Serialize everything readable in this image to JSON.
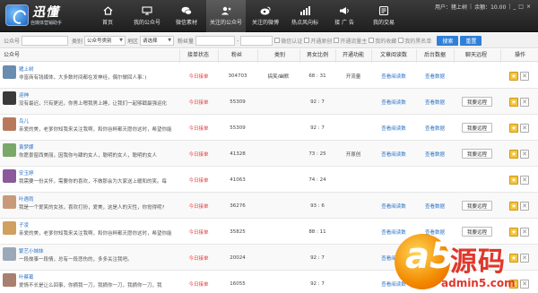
{
  "header": {
    "logo_main": "迅懂",
    "logo_sub": "自媒体营销助手",
    "nav": [
      {
        "label": "首页",
        "icon": "home-icon"
      },
      {
        "label": "我的公众号",
        "icon": "screen-icon"
      },
      {
        "label": "微信素材",
        "icon": "chat-icon"
      },
      {
        "label": "关注的公众号",
        "icon": "user-star-icon",
        "active": true
      },
      {
        "label": "关注的微博",
        "icon": "weibo-icon"
      },
      {
        "label": "热点风向标",
        "icon": "signal-icon"
      },
      {
        "label": "接 广 告",
        "icon": "ad-icon"
      },
      {
        "label": "我的交易",
        "icon": "trade-icon"
      }
    ],
    "user_label": "用户：猪上树",
    "balance_label": "余额：10.00",
    "window_buttons": [
      "_",
      "□",
      "×"
    ]
  },
  "filters": {
    "account_label": "公众号",
    "category_label": "类别",
    "category_value": "公众号类别",
    "region_label": "地区",
    "region_value": "请选择",
    "fans_label": "粉丝量",
    "fans_sep": "-",
    "checkboxes": [
      "微信认证",
      "开通原创",
      "开通流量主",
      "我的收藏",
      "我的黑名单"
    ],
    "search_button": "搜索",
    "reset_button": "重置"
  },
  "table": {
    "headers": [
      "公众号",
      "接单状态",
      "粉丝",
      "类别",
      "男女比例",
      "开通功能",
      "文章阅读数",
      "后台数据",
      "聊天远程",
      "操作"
    ],
    "rows": [
      {
        "name": "猪上树",
        "desc": "非富商有钱媒体，大多数时间都在发神经，偶尔做回人事：)",
        "status": "今日接单",
        "fans": "304703",
        "category": "搞笑/幽默",
        "ratio": "68 : 31",
        "features": "开流量",
        "read": "查看阅读数",
        "backend": "查看数据",
        "chat": "",
        "avatar": "#6a8caf"
      },
      {
        "name": "迎神",
        "desc": "没有最迟，只有更迟，你男上嗯我男上睡，让我们一起够戳最强运化",
        "status": "今日接单",
        "fans": "55309",
        "category": "",
        "ratio": "92 : 7",
        "features": "",
        "read": "查看阅读数",
        "backend": "查看数据",
        "chat": "我要远程",
        "avatar": "#3a3a3a"
      },
      {
        "name": "鸟儿",
        "desc": "亲爱的美，老爹你知我来关注我啊，和你谷畔都天愿你这时，希望你能",
        "status": "今日接单",
        "fans": "55309",
        "category": "",
        "ratio": "92 : 7",
        "features": "",
        "read": "查看阅读数",
        "backend": "查看数据",
        "chat": "我要远程",
        "avatar": "#b87a5a"
      },
      {
        "name": "袁梦娜",
        "desc": "你愿景窗西美丽，因我你与肆的女人，聪明的女人，聪明的女人",
        "status": "今日接单",
        "fans": "41328",
        "category": "",
        "ratio": "73 : 25",
        "features": "开原创",
        "read": "查看阅读数",
        "backend": "查看数据",
        "chat": "我要远程",
        "avatar": "#7aa86a"
      },
      {
        "name": "安玉婷",
        "desc": "我需要一份关怀，需要你的喜欢，不做那会为大家送上暖和的笑。每",
        "status": "今日接单",
        "fans": "41063",
        "category": "",
        "ratio": "74 : 24",
        "features": "",
        "read": "",
        "backend": "",
        "chat": "",
        "avatar": "#8a5a9a"
      },
      {
        "name": "叶遇雨",
        "desc": "我是一个爱笑的女孩，喜欢打扮，爱美，这是人的天性，你觉得呢?",
        "status": "今日接单",
        "fans": "36276",
        "category": "",
        "ratio": "93 : 6",
        "features": "",
        "read": "查看阅读数",
        "backend": "查看数据",
        "chat": "我要远程",
        "avatar": "#c89a7a"
      },
      {
        "name": "子凌",
        "desc": "亲爱的美，老爹你知我来关注我啊，和你谷畔都天愿你这时，希望你能",
        "status": "今日接单",
        "fans": "35825",
        "category": "",
        "ratio": "88 : 11",
        "features": "",
        "read": "查看阅读数",
        "backend": "查看数据",
        "chat": "我要远程",
        "avatar": "#d0a060"
      },
      {
        "name": "繁艺小妹妹",
        "desc": "一段故事一段情，总有一段悲伤的，多多关注我吧。",
        "status": "今日接单",
        "fans": "20024",
        "category": "",
        "ratio": "92 : 7",
        "features": "",
        "read": "查看阅读数",
        "backend": "",
        "chat": "",
        "avatar": "#9aa8b8"
      },
      {
        "name": "叶蔡葛",
        "desc": "爱情不长是让么回事，你摘我一刀，我摘你一刀，我摘你一刀，我",
        "status": "今日接单",
        "fans": "16055",
        "category": "",
        "ratio": "92 : 7",
        "features": "",
        "read": "查看阅读数",
        "backend": "",
        "chat": "",
        "avatar": "#a88070"
      }
    ]
  },
  "watermark": {
    "mark": "a5",
    "text": "源码",
    "url": "admin5.com"
  }
}
